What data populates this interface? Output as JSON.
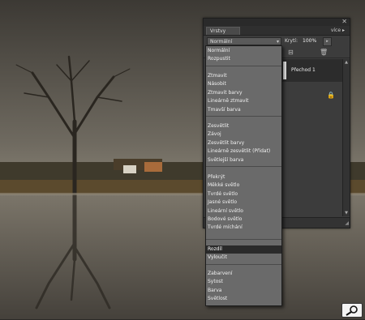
{
  "colors": {
    "accent": "#2a2a2a",
    "panel": "#3c3c3c",
    "menu": "#6a6a6a"
  },
  "panel": {
    "tab_label": "Vrstvy",
    "more_label": "více",
    "close_icon": "close-icon",
    "blend_mode_value": "Normální",
    "opacity_label": "Krytí:",
    "opacity_value": "100%",
    "layer_name": "Přechod 1"
  },
  "dropdown": {
    "selected_index": 19,
    "groups": [
      [
        "Normální",
        "Rozpustit"
      ],
      [
        "Ztmavit",
        "Násobit",
        "Ztmavit barvy",
        "Lineárně ztmavit",
        "Tmavší barva"
      ],
      [
        "Zesvětlit",
        "Závoj",
        "Zesvětlit barvy",
        "Lineárně zesvětlit (Přidat)",
        "Světlejší barva"
      ],
      [
        "Překrýt",
        "Měkké světlo",
        "Tvrdé světlo",
        "Jasné světlo",
        "Lineární světlo",
        "Bodové světlo",
        "Tvrdé míchání"
      ],
      [
        "Rozdíl",
        "Vyloučit"
      ],
      [
        "Zabarvení",
        "Sytost",
        "Barva",
        "Světlost"
      ]
    ]
  }
}
